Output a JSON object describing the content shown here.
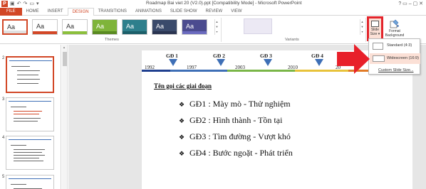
{
  "titlebar": {
    "app_icon": "P",
    "document_title": "Roadmap Bai viet 20 (V2.0).ppt [Compatibility Mode] - Microsoft PowerPoint",
    "window_controls": "? ▭ – ▢ ✕"
  },
  "ribbon_tabs": [
    "FILE",
    "HOME",
    "INSERT",
    "DESIGN",
    "TRANSITIONS",
    "ANIMATIONS",
    "SLIDE SHOW",
    "REVIEW",
    "VIEW"
  ],
  "active_tab": "DESIGN",
  "themes": {
    "group_label": "Themes",
    "items": [
      {
        "text": "Aa",
        "bg": "#ffffff",
        "fg": "#333333",
        "accent": "#e0e0e0"
      },
      {
        "text": "Aa",
        "bg": "#ffffff",
        "fg": "#333333",
        "accent": "#d24726"
      },
      {
        "text": "Aa",
        "bg": "#ffffff",
        "fg": "#333333",
        "accent": "#8bbf3c"
      },
      {
        "text": "Aa",
        "bg": "#7fb43a",
        "fg": "#ffffff",
        "accent": "#5a8a22"
      },
      {
        "text": "Aa",
        "bg": "#2e7f8c",
        "fg": "#ffffff",
        "accent": "#1c5f69"
      },
      {
        "text": "Aa",
        "bg": "#3a4a6b",
        "fg": "#ffffff",
        "accent": "#2a3450"
      },
      {
        "text": "Aa",
        "bg": "#4b4b8f",
        "fg": "#ffffff",
        "accent": "#6b6bbf"
      }
    ]
  },
  "variants": {
    "group_label": "Variants"
  },
  "slide_size_button": {
    "label_line1": "Slide",
    "label_line2": "Size ▾"
  },
  "format_background_button": {
    "label_line1": "Format",
    "label_line2": "Background"
  },
  "slide_size_menu": {
    "items": [
      {
        "label": "Standard (4:3)"
      },
      {
        "label": "Widescreen (16:9)"
      }
    ],
    "custom_label": "Custom Slide Size..."
  },
  "thumbnails": {
    "numbers": [
      "2",
      "3",
      "4",
      "5"
    ]
  },
  "slide": {
    "timeline": {
      "years": [
        "1992",
        "1997",
        "2003",
        "2010",
        "20"
      ],
      "phases": [
        "GĐ 1",
        "GĐ 2",
        "GĐ 3",
        "GĐ 4"
      ],
      "bar_colors": [
        "#1f3f8f",
        "#3e6fb6",
        "#7ab648",
        "#e8c33b",
        "#e27b27"
      ]
    },
    "heading": "Tên gọi các giai đoạn",
    "bullets": [
      "GĐ1 : Mày mò - Thử nghiệm",
      "GĐ2 : Hình thành - Tồn tại",
      "GĐ3 : Tìm đường - Vượt khó",
      "GĐ4 : Bước ngoặt - Phát triển"
    ],
    "bullet_symbol": "❖"
  },
  "colors": {
    "accent": "#d24726",
    "highlight_box": "#e3242b",
    "arrow": "#e8202a"
  }
}
